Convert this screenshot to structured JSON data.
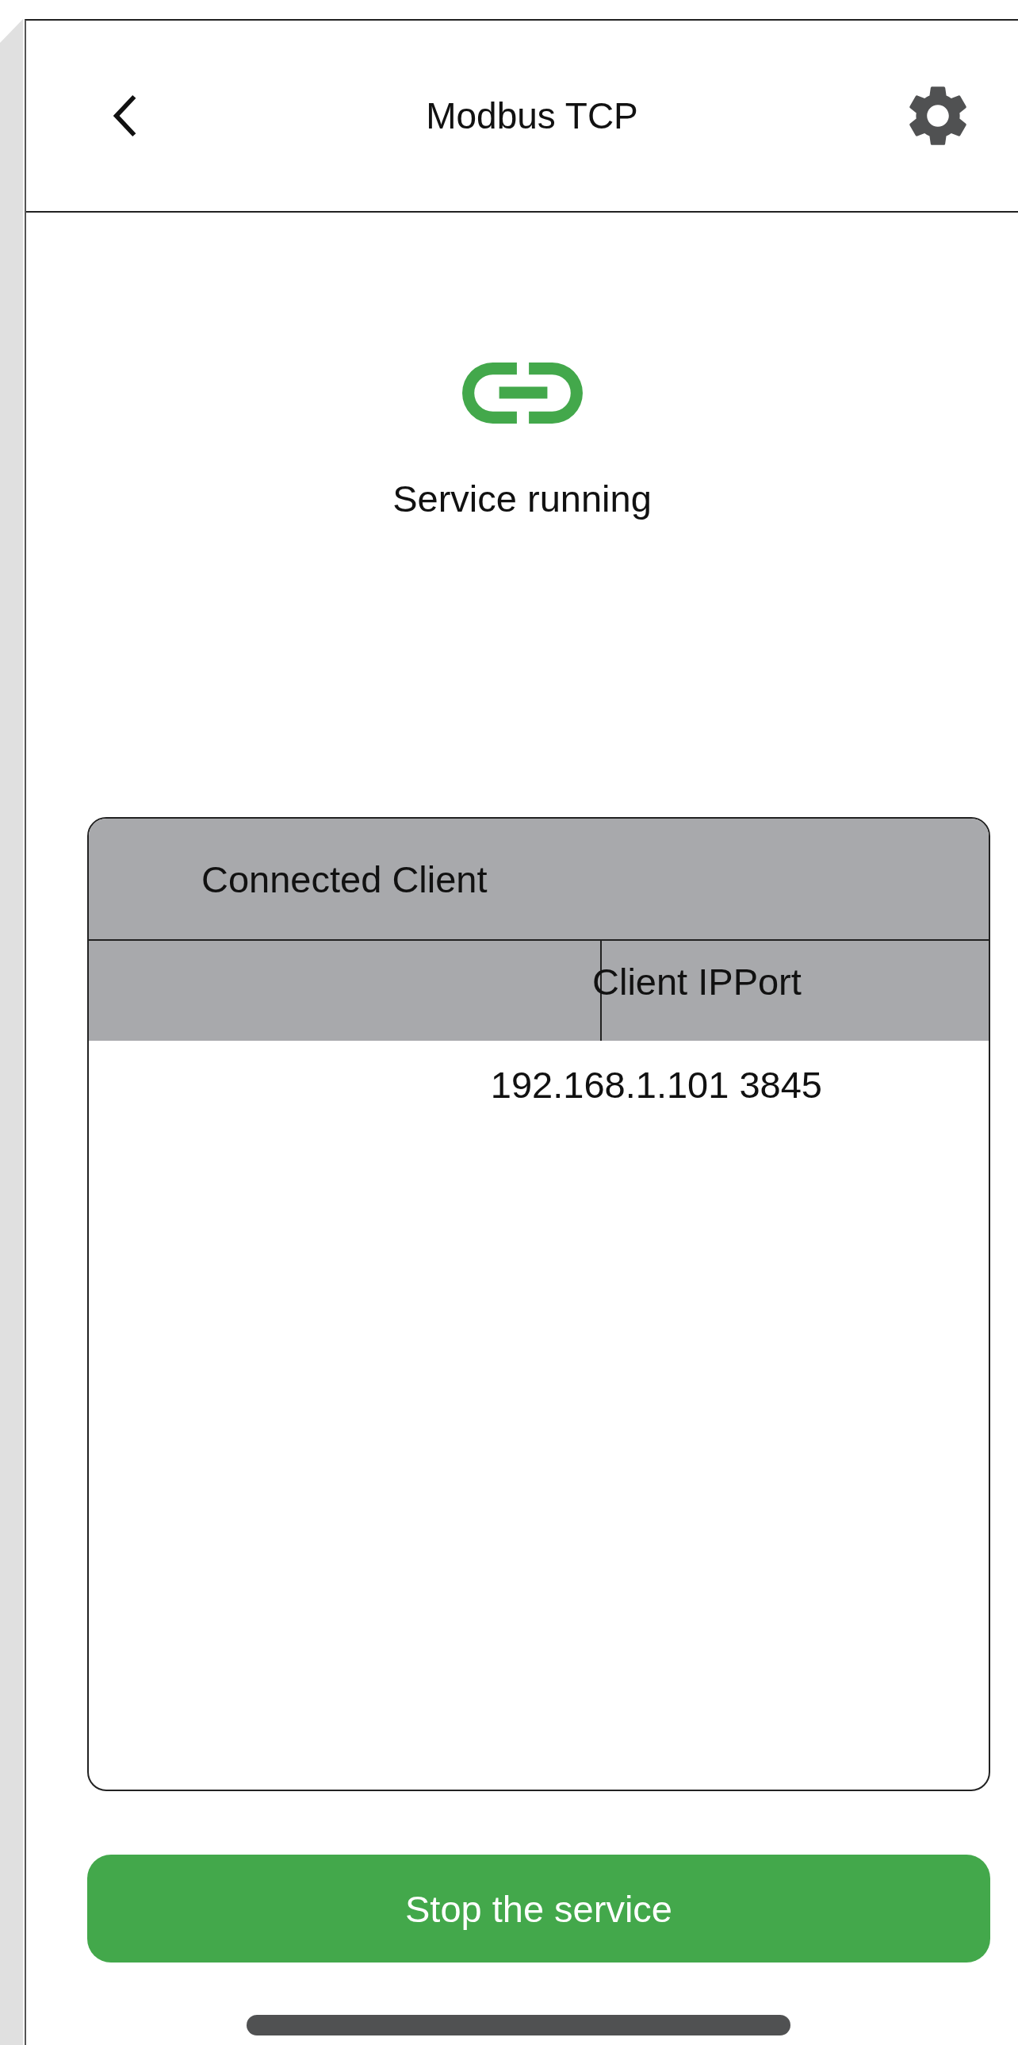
{
  "header": {
    "title": "Modbus TCP"
  },
  "status": {
    "text": "Service running",
    "running": true
  },
  "table": {
    "title": "Connected Client",
    "columns": [
      "Client IPPort"
    ],
    "rows": [
      [
        "192.168.1.101 3845"
      ]
    ]
  },
  "button": {
    "label": "Stop the service"
  }
}
